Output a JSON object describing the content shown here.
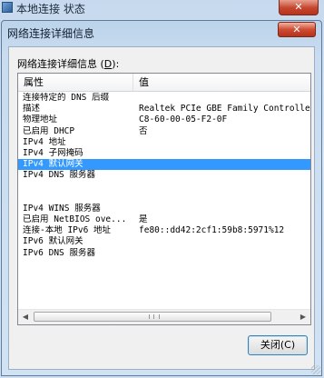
{
  "background_window": {
    "title": "本地连接 状态",
    "close_glyph": "✕"
  },
  "dialog": {
    "title": "网络连接详细信息",
    "close_glyph": "✕",
    "caption_prefix": "网络连接详细信息 (",
    "caption_key": "D",
    "caption_suffix": "):",
    "columns": {
      "property": "属性",
      "value": "值"
    },
    "rows": [
      {
        "property": "连接特定的 DNS 后缀",
        "value": ""
      },
      {
        "property": "描述",
        "value": "Realtek PCIe GBE Family Controlle"
      },
      {
        "property": "物理地址",
        "value": "C8-60-00-05-F2-0F"
      },
      {
        "property": "已启用 DHCP",
        "value": "否"
      },
      {
        "property": "IPv4 地址",
        "value": ""
      },
      {
        "property": "IPv4 子网掩码",
        "value": ""
      },
      {
        "property": "IPv4 默认网关",
        "value": "",
        "selected": true
      },
      {
        "property": "IPv4 DNS 服务器",
        "value": ""
      },
      {
        "property": "",
        "value": ""
      },
      {
        "property": "",
        "value": ""
      },
      {
        "property": "IPv4 WINS 服务器",
        "value": ""
      },
      {
        "property": "已启用 NetBIOS ove...",
        "value": "是"
      },
      {
        "property": "连接-本地 IPv6 地址",
        "value": "fe80::dd42:2cf1:59b8:5971%12"
      },
      {
        "property": "IPv6 默认网关",
        "value": ""
      },
      {
        "property": "IPv6 DNS 服务器",
        "value": ""
      }
    ],
    "scroll_left_glyph": "◀",
    "scroll_right_glyph": "▶",
    "close_button_label": "关闭(C)"
  },
  "colors": {
    "selection": "#3399ff",
    "button_border": "#3c7fb1"
  },
  "icons": [
    "app-icon",
    "close-icon",
    "scroll-left-arrow-icon",
    "scroll-right-arrow-icon",
    "resize-grip-icon"
  ]
}
